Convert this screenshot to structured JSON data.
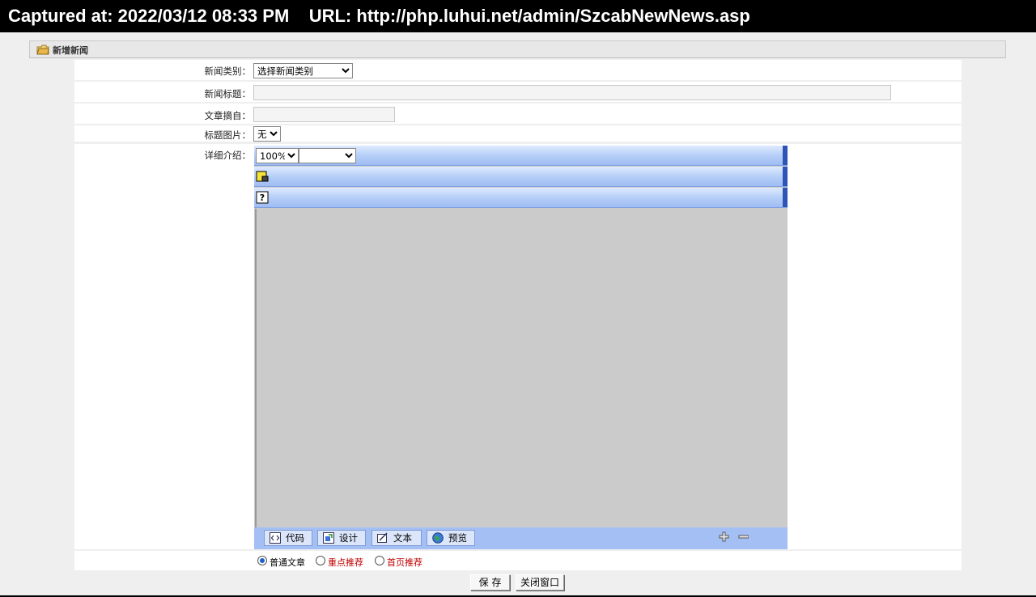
{
  "capture": {
    "text": "Captured at: 2022/03/12 08:33 PM    URL: http://php.luhui.net/admin/SzcabNewNews.asp"
  },
  "panel": {
    "title": "新增新闻",
    "icon": "folder-icon"
  },
  "form": {
    "category": {
      "label": "新闻类别：",
      "selected": "选择新闻类别"
    },
    "title": {
      "label": "新闻标题：",
      "value": ""
    },
    "excerpt": {
      "label": "文章摘自：",
      "value": ""
    },
    "title_image": {
      "label": "标题图片：",
      "selected": "无"
    },
    "detail": {
      "label": "详细介绍："
    }
  },
  "editor": {
    "zoom": "100%",
    "font": "",
    "modes": [
      {
        "label": "代码",
        "icon": "code-icon"
      },
      {
        "label": "设计",
        "icon": "design-icon"
      },
      {
        "label": "文本",
        "icon": "text-icon"
      },
      {
        "label": "预览",
        "icon": "globe-icon"
      }
    ],
    "enlarge": "plus-icon",
    "shrink": "minus-icon"
  },
  "article_type": {
    "options": [
      "普通文章",
      "重点推荐",
      "首页推荐"
    ],
    "selected": "普通文章"
  },
  "buttons": {
    "save": "保 存",
    "close": "关闭窗口"
  }
}
